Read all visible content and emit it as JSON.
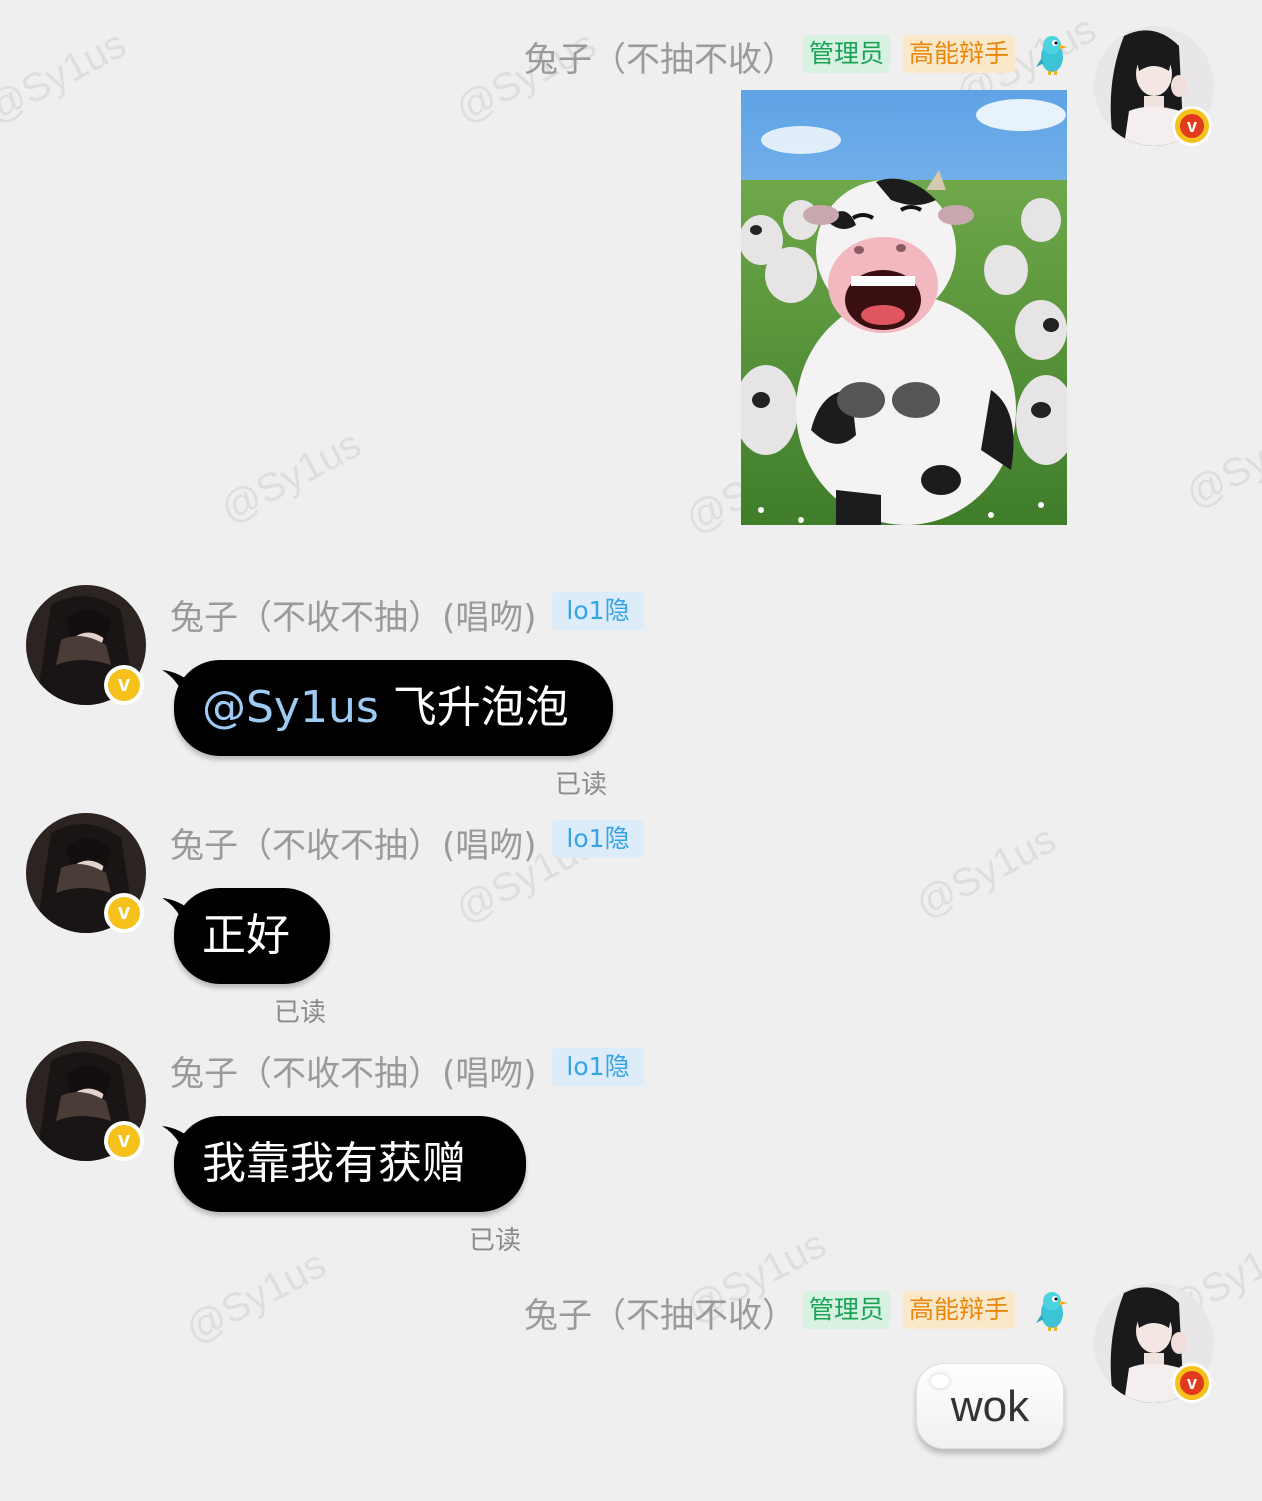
{
  "watermark_text": "@Sy1us",
  "self_user": {
    "name": "兔子（不抽不收）",
    "badges": [
      {
        "label": "管理员",
        "color": "#18a356"
      },
      {
        "label": "高能辩手",
        "color": "#e8870c"
      }
    ],
    "avatar_icon": "woman-avatar-icon",
    "verified_icon": "v-badge-icon"
  },
  "other_user": {
    "name": "兔子（不收不抽）(唱吻)",
    "badge": {
      "label": "lo1隐",
      "color": "#38a2e6"
    },
    "avatar_icon": "dark-hood-avatar-icon",
    "verified_icon": "v-badge-icon"
  },
  "messages": [
    {
      "sender": "self",
      "type": "image",
      "image_icon": "laughing-cow-sticker"
    },
    {
      "sender": "other",
      "mention": "@Sy1us",
      "text": " 飞升泡泡",
      "status": "已读"
    },
    {
      "sender": "other",
      "text": "正好",
      "status": "已读"
    },
    {
      "sender": "other",
      "text": "我靠我有获赠",
      "status": "已读"
    },
    {
      "sender": "self",
      "text": "wok"
    }
  ]
}
